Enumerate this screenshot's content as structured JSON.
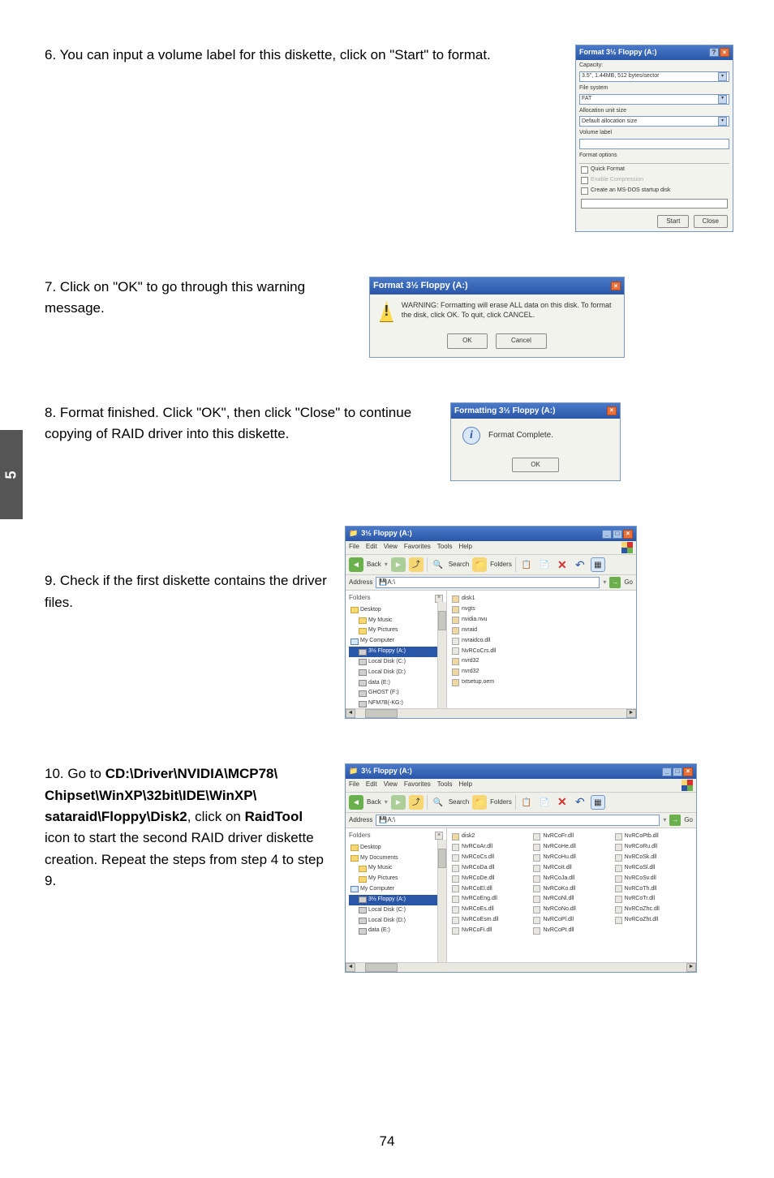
{
  "side_tab": "5",
  "page_number": "74",
  "steps": {
    "s6": {
      "num": "6.",
      "text": "You can input a volume label for this diskette, click on \"Start\" to format."
    },
    "s7": {
      "num": "7.",
      "text": "Click on \"OK\" to go through this warning message."
    },
    "s8": {
      "num": "8.",
      "text": "Format finished. Click \"OK\", then click \"Close\" to continue copying of RAID driver into this diskette."
    },
    "s9": {
      "num": "9.",
      "text": "Check if the first diskette contains the driver files."
    },
    "s10": {
      "num": "10.",
      "text_a": "Go to ",
      "bold": "CD:\\Driver\\NVIDIA\\MCP78\\ Chipset\\WinXP\\32bit\\IDE\\WinXP\\ sataraid\\Floppy\\Disk2",
      "text_b": ", click on ",
      "bold2": "RaidTool",
      "text_c": " icon to start the second RAID driver diskette creation. Repeat the steps from step 4 to step 9."
    }
  },
  "format_dialog": {
    "title": "Format 3½ Floppy (A:)",
    "capacity_label": "Capacity:",
    "capacity_value": "3.5\", 1.44MB, 512 bytes/sector",
    "filesystem_label": "File system",
    "filesystem_value": "FAT",
    "alloc_label": "Allocation unit size",
    "alloc_value": "Default allocation size",
    "volume_label": "Volume label",
    "volume_value": "",
    "options_label": "Format options",
    "opt_quick": "Quick Format",
    "opt_compress": "Enable Compression",
    "opt_msdos": "Create an MS-DOS startup disk",
    "btn_start": "Start",
    "btn_close": "Close"
  },
  "warning_dialog": {
    "title": "Format 3½ Floppy (A:)",
    "text": "WARNING: Formatting will erase ALL data on this disk. To format the disk, click OK. To quit, click CANCEL.",
    "btn_ok": "OK",
    "btn_cancel": "Cancel"
  },
  "complete_dialog": {
    "title": "Formatting 3½ Floppy (A:)",
    "text": "Format Complete.",
    "btn_ok": "OK"
  },
  "explorer1": {
    "title": "3½ Floppy (A:)",
    "menu": [
      "File",
      "Edit",
      "View",
      "Favorites",
      "Tools",
      "Help"
    ],
    "toolbar": {
      "back": "Back",
      "search": "Search",
      "folders": "Folders"
    },
    "address_label": "Address",
    "address_value": "A:\\",
    "go": "Go",
    "tree_header": "Folders",
    "tree": [
      {
        "label": "Desktop",
        "lvl": 1,
        "icon": "folder"
      },
      {
        "label": "My Music",
        "lvl": 2,
        "icon": "folder"
      },
      {
        "label": "My Pictures",
        "lvl": 2,
        "icon": "folder"
      },
      {
        "label": "My Computer",
        "lvl": 1,
        "icon": "comp"
      },
      {
        "label": "3½ Floppy (A:)",
        "lvl": 2,
        "icon": "drive",
        "sel": true
      },
      {
        "label": "Local Disk (C:)",
        "lvl": 2,
        "icon": "drive"
      },
      {
        "label": "Local Disk (D:)",
        "lvl": 2,
        "icon": "drive"
      },
      {
        "label": "data (E:)",
        "lvl": 2,
        "icon": "drive"
      },
      {
        "label": "GHOST (F:)",
        "lvl": 2,
        "icon": "drive"
      },
      {
        "label": "NFM7B(-KG:)",
        "lvl": 2,
        "icon": "drive"
      }
    ],
    "files": [
      "disk1",
      "nvgts",
      "nvidia.nvu",
      "nvraid",
      "nvraidco.dll",
      "NvRCoCrs.dll",
      "nvrd32",
      "nvrd32",
      "txtsetup.oem"
    ]
  },
  "explorer2": {
    "title": "3½ Floppy (A:)",
    "menu": [
      "File",
      "Edit",
      "View",
      "Favorites",
      "Tools",
      "Help"
    ],
    "toolbar": {
      "back": "Back",
      "search": "Search",
      "folders": "Folders"
    },
    "address_label": "Address",
    "address_value": "A:\\",
    "go": "Go",
    "tree_header": "Folders",
    "tree": [
      {
        "label": "Desktop",
        "lvl": 1,
        "icon": "folder"
      },
      {
        "label": "My Documents",
        "lvl": 1,
        "icon": "folder"
      },
      {
        "label": "My Music",
        "lvl": 2,
        "icon": "folder"
      },
      {
        "label": "My Pictures",
        "lvl": 2,
        "icon": "folder"
      },
      {
        "label": "My Computer",
        "lvl": 1,
        "icon": "comp"
      },
      {
        "label": "3½ Floppy (A:)",
        "lvl": 2,
        "icon": "drive",
        "sel": true
      },
      {
        "label": "Local Disk (C:)",
        "lvl": 2,
        "icon": "drive"
      },
      {
        "label": "Local Disk (D:)",
        "lvl": 2,
        "icon": "drive"
      },
      {
        "label": "data (E:)",
        "lvl": 2,
        "icon": "drive"
      }
    ],
    "files_col1": [
      "disk2",
      "NvRCoAr.dll",
      "NvRCoCs.dll",
      "NvRCoDa.dll",
      "NvRCoDe.dll",
      "NvRCoEl.dll",
      "NvRCoEng.dll",
      "NvRCoEs.dll",
      "NvRCoEsm.dll",
      "NvRCoFi.dll"
    ],
    "files_col2": [
      "NvRCoFr.dll",
      "NvRCoHe.dll",
      "NvRCoHu.dll",
      "NvRCoIt.dll",
      "NvRCoJa.dll",
      "NvRCoKo.dll",
      "NvRCoNl.dll",
      "NvRCoNo.dll",
      "NvRCoPl.dll",
      "NvRCoPt.dll"
    ],
    "files_col3": [
      "NvRCoPtb.dll",
      "NvRCoRu.dll",
      "NvRCoSk.dll",
      "NvRCoSl.dll",
      "NvRCoSv.dll",
      "NvRCoTh.dll",
      "NvRCoTr.dll",
      "NvRCoZhc.dll",
      "NvRCoZht.dll"
    ]
  }
}
